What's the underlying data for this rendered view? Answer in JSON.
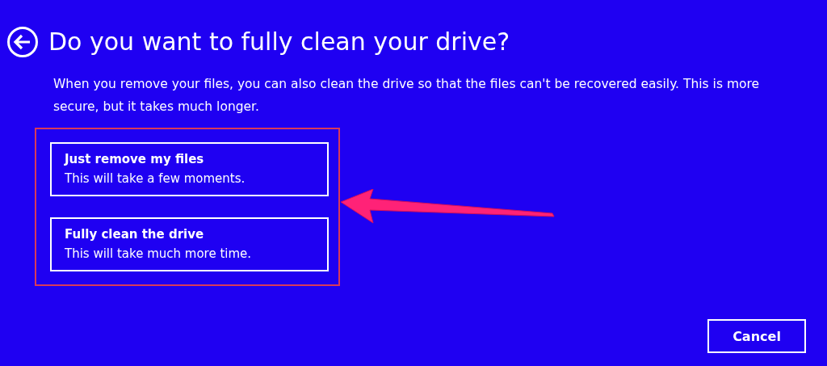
{
  "page": {
    "title": "Do you want to fully clean your drive?",
    "description": "When you remove your files, you can also clean the drive so that the files can't be recovered easily. This is more secure, but it takes much longer."
  },
  "options": [
    {
      "title": "Just remove my files",
      "subtitle": "This will take a few moments."
    },
    {
      "title": "Fully clean the drive",
      "subtitle": "This will take much more time."
    }
  ],
  "buttons": [
    {
      "label": "Cancel"
    }
  ]
}
